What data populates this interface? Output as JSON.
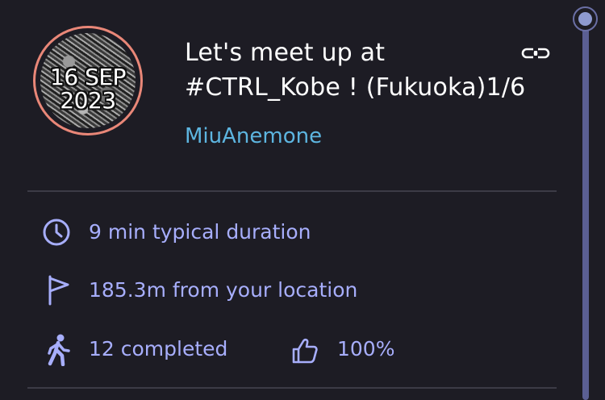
{
  "badge": {
    "date_line1": "16 SEP",
    "date_line2": "2023",
    "border_color": "#e98778"
  },
  "title": {
    "line1": "Let's meet up at",
    "line2": "#CTRL_Kobe ! (Fukuoka)1/6"
  },
  "author": "MiuAnemone",
  "stats": {
    "duration": "9 min typical duration",
    "distance": "185.3m from your location",
    "completed": "12 completed",
    "rating": "100%"
  },
  "icons": {
    "share": "link-icon",
    "duration": "clock-icon",
    "distance": "flag-icon",
    "completed": "walking-icon",
    "rating": "thumbs-up-icon"
  },
  "colors": {
    "background": "#1d1c24",
    "title": "#ffffff",
    "author": "#5db5e0",
    "stat_text": "#a7aefc",
    "scroll_track": "#5b5f93"
  }
}
